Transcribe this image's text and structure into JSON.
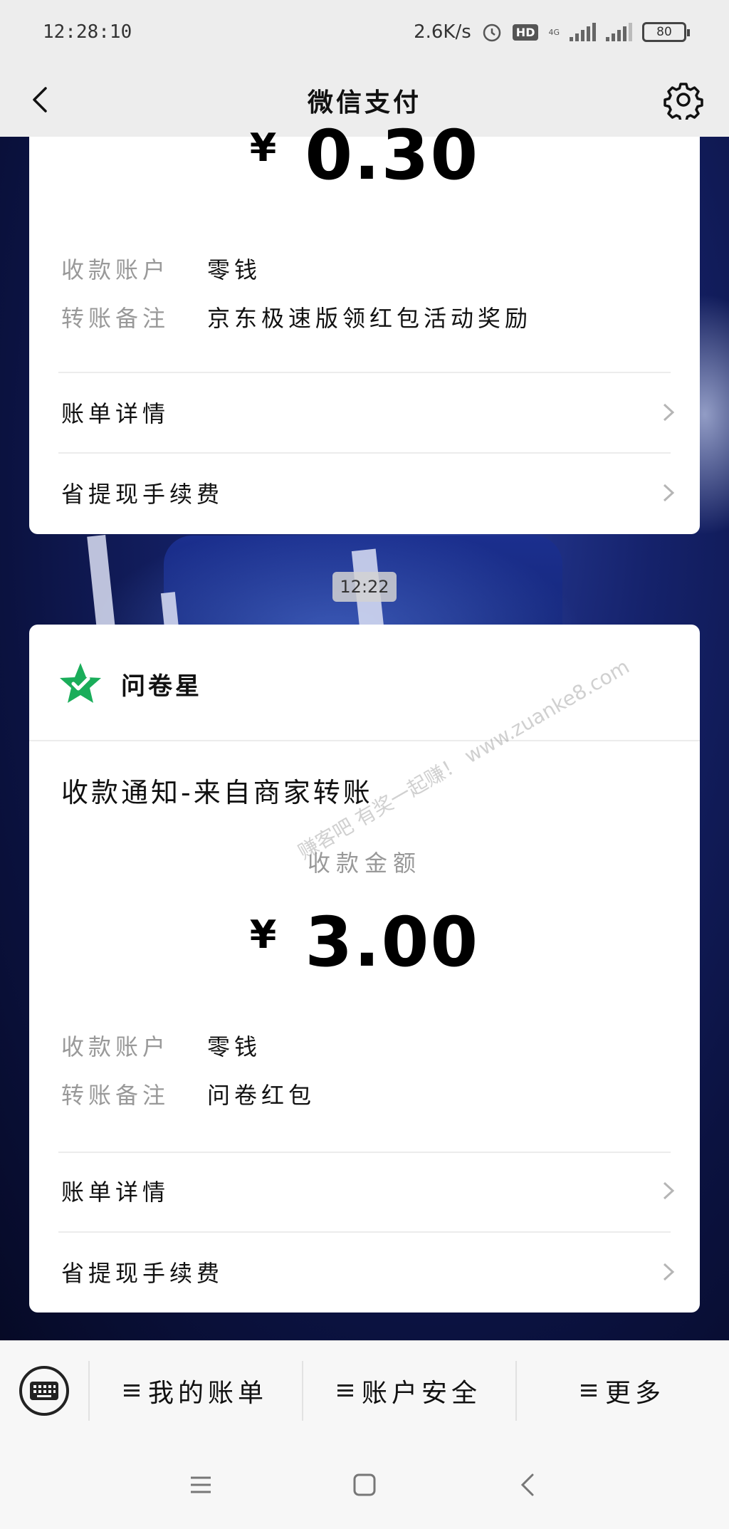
{
  "status_bar": {
    "time": "12:28:10",
    "net_speed": "2.6K/s",
    "hd": "HD",
    "network": "4G",
    "battery": "80"
  },
  "nav": {
    "title": "微信支付"
  },
  "card1": {
    "currency": "¥",
    "amount": "0.30",
    "account_label": "收款账户",
    "account_value": "零钱",
    "remark_label": "转账备注",
    "remark_value": "京东极速版领红包活动奖励",
    "bill_details": "账单详情",
    "save_fee": "省提现手续费"
  },
  "timestamp": "12:22",
  "card2": {
    "merchant_name": "问卷星",
    "notice_title": "收款通知-来自商家转账",
    "amount_label": "收款金额",
    "currency": "¥",
    "amount": "3.00",
    "account_label": "收款账户",
    "account_value": "零钱",
    "remark_label": "转账备注",
    "remark_value": "问卷红包",
    "bill_details": "账单详情",
    "save_fee": "省提现手续费"
  },
  "watermark": "赚客吧 有奖一起赚！ www.zuanke8.com",
  "bottom_menu": {
    "my_bill": "我的账单",
    "account_security": "账户安全",
    "more": "更多"
  },
  "colors": {
    "accent_green": "#1aad5a",
    "header_bg": "#ededed"
  }
}
